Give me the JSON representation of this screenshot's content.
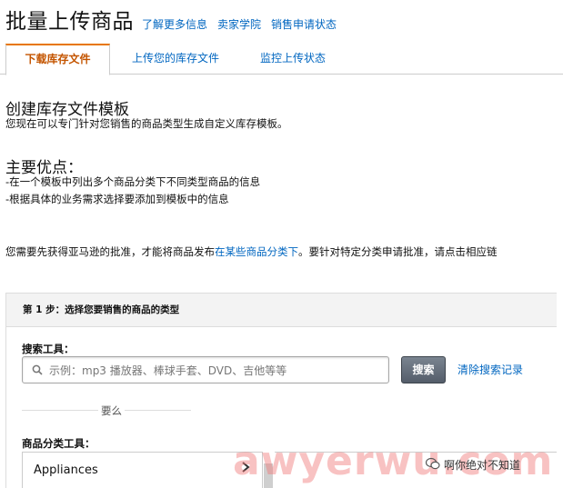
{
  "header": {
    "title": "批量上传商品",
    "links": [
      "了解更多信息",
      "卖家学院",
      "销售申请状态"
    ]
  },
  "tabs": [
    {
      "label": "下载库存文件",
      "active": true
    },
    {
      "label": "上传您的库存文件",
      "active": false
    },
    {
      "label": "监控上传状态",
      "active": false
    }
  ],
  "template_section": {
    "heading": "创建库存文件模板",
    "description": "您现在可以专门针对您销售的商品类型生成自定义库存模板。"
  },
  "advantages": {
    "heading": "主要优点：",
    "points": [
      "-在一个模板中列出多个商品分类下不同类型商品的信息",
      "-根据具体的业务需求选择要添加到模板中的信息"
    ]
  },
  "approval_notice": {
    "before_link": "您需要先获得亚马逊的批准，才能将商品发布",
    "link": "在某些商品分类下",
    "after_link": "。要针对特定分类申请批准，请点击相应链"
  },
  "step1": {
    "title": "第 1 步：选择您要销售的商品的类型",
    "search_label": "搜索工具：",
    "search_placeholder": "示例：mp3 播放器、棒球手套、DVD、吉他等等",
    "search_button": "搜索",
    "clear_link": "清除搜索记录",
    "or_text": "要么",
    "category_label": "商品分类工具：",
    "categories": [
      "Appliances"
    ]
  },
  "watermark": {
    "text": "awyerwu.com",
    "wechat_label": "啊你绝对不知道"
  },
  "colors": {
    "link": "#0066c0",
    "active_tab": "#c45500",
    "tab_accent": "#e77600",
    "button": "#545d6a"
  }
}
